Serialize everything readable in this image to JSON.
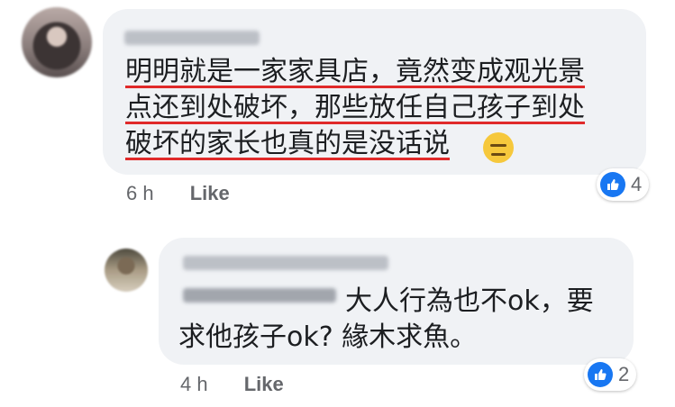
{
  "comment": {
    "lines": [
      "明明就是一家家具店，竟然变成观光景",
      "点还到处破坏，那些放任自己孩子到处",
      "破坏的家长也真的是没话说"
    ],
    "emoji": "expressionless-face",
    "time": "6 h",
    "like_label": "Like",
    "reaction_count": "4"
  },
  "reply": {
    "text": "大人行為也不ok，要求他孩子ok? 緣木求魚。",
    "time": "4 h",
    "like_label": "Like",
    "reaction_count": "2"
  },
  "colors": {
    "bubble": "#f0f2f5",
    "underline": "#e02a2a",
    "like_blue": "#1877f2",
    "meta_gray": "#65676b"
  }
}
